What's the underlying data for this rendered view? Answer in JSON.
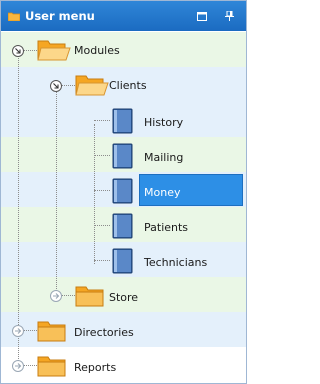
{
  "window": {
    "title": "User menu",
    "icons": {
      "title": "folder-icon",
      "restore": "restore-window-icon",
      "pin": "pin-icon"
    },
    "colors": {
      "titlebar": "#1f74cc",
      "selected": "#2d8fe6",
      "row_green": "#eaf7e6",
      "row_blue": "#e4f0fb"
    }
  },
  "tree": {
    "modules": {
      "label": "Modules",
      "expanded": true,
      "icon": "folder-open-icon"
    },
    "clients": {
      "label": "Clients",
      "expanded": true,
      "icon": "folder-open-icon"
    },
    "items": [
      {
        "label": "History",
        "icon": "book-icon"
      },
      {
        "label": "Mailing",
        "icon": "book-icon"
      },
      {
        "label": "Money",
        "icon": "book-icon",
        "selected": true
      },
      {
        "label": "Patients",
        "icon": "book-icon"
      },
      {
        "label": "Technicians",
        "icon": "book-icon"
      }
    ],
    "store": {
      "label": "Store",
      "expanded": false,
      "icon": "folder-icon"
    },
    "directories": {
      "label": "Directories",
      "expanded": false,
      "icon": "folder-icon"
    },
    "reports": {
      "label": "Reports",
      "expanded": false,
      "icon": "folder-icon"
    }
  }
}
